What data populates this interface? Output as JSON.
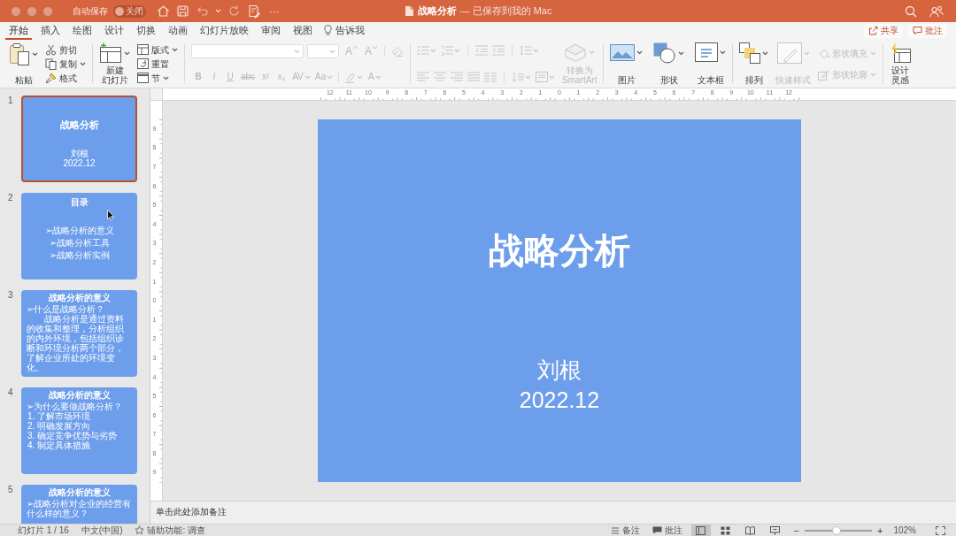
{
  "title_bar": {
    "autosave_label": "自动保存",
    "autosave": {
      "label": "关闭",
      "on": false
    },
    "more": "···",
    "document_title": "战略分析",
    "save_status": "— 已保存到我的 Mac"
  },
  "tabs": [
    {
      "label": "开始",
      "selected": true
    },
    {
      "label": "插入",
      "selected": false
    },
    {
      "label": "绘图",
      "selected": false
    },
    {
      "label": "设计",
      "selected": false
    },
    {
      "label": "切换",
      "selected": false
    },
    {
      "label": "动画",
      "selected": false
    },
    {
      "label": "幻灯片放映",
      "selected": false
    },
    {
      "label": "审阅",
      "selected": false
    },
    {
      "label": "视图",
      "selected": false
    }
  ],
  "tell_me": "告诉我",
  "share_button": "共享",
  "comments_button": "批注",
  "ribbon": {
    "paste": {
      "label": "粘贴",
      "disabled": false
    },
    "clipboard": [
      {
        "label": "剪切",
        "kind": "cut",
        "disabled": false
      },
      {
        "label": "复制",
        "kind": "copy",
        "disabled": false
      },
      {
        "label": "格式",
        "kind": "format",
        "disabled": false
      }
    ],
    "new_slide": {
      "lines": [
        "新建",
        "幻灯片"
      ],
      "disabled": false
    },
    "slide": [
      {
        "label": "版式",
        "kind": "layout",
        "disabled": false
      },
      {
        "label": "重置",
        "kind": "reset",
        "disabled": false
      },
      {
        "label": "节",
        "kind": "section",
        "disabled": false
      }
    ],
    "font": {
      "disabled": true,
      "size_buttons": [
        "A",
        "A"
      ],
      "format_buttons": [
        "B",
        "I",
        "U",
        "abc",
        "x²",
        "x₂"
      ],
      "spacing_button": "AV",
      "case_button": "Aa",
      "color_button": "A"
    },
    "paragraph": {
      "disabled": true
    },
    "smartart": {
      "lines": [
        "转换为",
        "SmartArt"
      ],
      "disabled": true
    },
    "insert": [
      {
        "label": "图片",
        "kind": "picture",
        "disabled": false
      },
      {
        "label": "形状",
        "kind": "shape",
        "disabled": false
      },
      {
        "label": "文本框",
        "kind": "textbox",
        "disabled": false
      }
    ],
    "arrange": {
      "label": "排列",
      "disabled": false
    },
    "quick_styles": {
      "label": "快速样式",
      "disabled": true
    },
    "shape_format": [
      {
        "label": "形状填充",
        "kind": "fill",
        "disabled": true
      },
      {
        "label": "形状轮廓",
        "kind": "outline",
        "disabled": true
      }
    ],
    "designer": {
      "lines": [
        "设计",
        "灵感"
      ],
      "disabled": false
    }
  },
  "ruler": {
    "horizontal": [
      "12",
      "11",
      "10",
      "9",
      "8",
      "7",
      "6",
      "5",
      "4",
      "3",
      "2",
      "1",
      "0",
      "1",
      "2",
      "3",
      "4",
      "5",
      "6",
      "7",
      "8",
      "9",
      "10",
      "11",
      "12"
    ],
    "vertical": [
      "9",
      "8",
      "7",
      "6",
      "5",
      "4",
      "3",
      "2",
      "1",
      "0",
      "1",
      "2",
      "3",
      "4",
      "5",
      "6",
      "7",
      "8",
      "9"
    ]
  },
  "thumbnails": [
    {
      "number": "1",
      "selected": true,
      "kind": "title",
      "title": "战略分析",
      "lines": [
        {
          "kind": "item",
          "text": "刘根"
        },
        {
          "kind": "item",
          "text": "2022.12"
        }
      ]
    },
    {
      "number": "2",
      "selected": false,
      "kind": "toc",
      "title": "目录",
      "lines": [
        {
          "kind": "item",
          "text": "➢战略分析的意义"
        },
        {
          "kind": "item",
          "text": "➢战略分析工具"
        },
        {
          "kind": "item",
          "text": "➢战略分析实例"
        }
      ]
    },
    {
      "number": "3",
      "selected": false,
      "kind": "content",
      "title": "战略分析的意义",
      "lines": [
        {
          "kind": "bullet",
          "text": "➢什么是战略分析？"
        },
        {
          "kind": "paragraph",
          "text": "战略分析是通过资料的收集和整理，分析组织的内外环境，包括组织诊断和环境分析两个部分，了解企业所处的环境变化。"
        }
      ]
    },
    {
      "number": "4",
      "selected": false,
      "kind": "content",
      "title": "战略分析的意义",
      "lines": [
        {
          "kind": "bullet",
          "text": "➢为什么要做战略分析？"
        },
        {
          "kind": "item",
          "text": "1.  了解市场环境"
        },
        {
          "kind": "item",
          "text": "2.  明确发展方向"
        },
        {
          "kind": "item",
          "text": "3.  确定竞争优势与劣势"
        },
        {
          "kind": "item",
          "text": "4.  制定具体措施"
        }
      ]
    },
    {
      "number": "5",
      "selected": false,
      "kind": "content",
      "title": "战略分析的意义",
      "lines": [
        {
          "kind": "bullet",
          "text": "➢战略分析对企业的经营有什么样的意义？"
        }
      ]
    }
  ],
  "slide": {
    "title": "战略分析",
    "author": "刘根",
    "date": "2022.12"
  },
  "notes": {
    "placeholder": "单击此处添加备注"
  },
  "status_bar": {
    "slide_counter": "幻灯片 1 / 16",
    "language": "中文(中国)",
    "accessibility": "辅助功能: 调查",
    "notes": "备注",
    "comments": "批注",
    "views": [
      {
        "kind": "normal",
        "selected": true
      },
      {
        "kind": "sorter",
        "selected": false
      },
      {
        "kind": "reading",
        "selected": false
      },
      {
        "kind": "slideshow",
        "selected": false
      }
    ],
    "zoom_minus": "−",
    "zoom": {
      "level": 0.47
    },
    "zoom_plus": "+",
    "zoom_value": "102%"
  }
}
